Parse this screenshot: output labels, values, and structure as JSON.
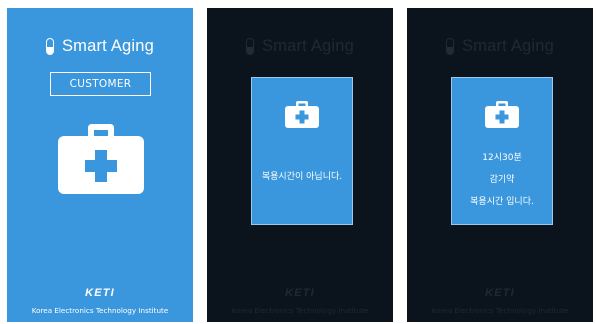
{
  "app": {
    "title": "Smart Aging"
  },
  "screen1": {
    "customer_button": "CUSTOMER",
    "logo": "KETI",
    "footer": "Korea Electronics Technology Institute"
  },
  "screen2": {
    "message": "복용시간이 아닙니다."
  },
  "screen3": {
    "time": "12시30분",
    "medicine": "감기약",
    "message": "복용시간 입니다."
  },
  "colors": {
    "accent_blue": "#3a97dd",
    "dark_background": "#0b141c",
    "white": "#ffffff"
  },
  "icons": [
    "pill-icon",
    "first-aid-kit-icon"
  ]
}
